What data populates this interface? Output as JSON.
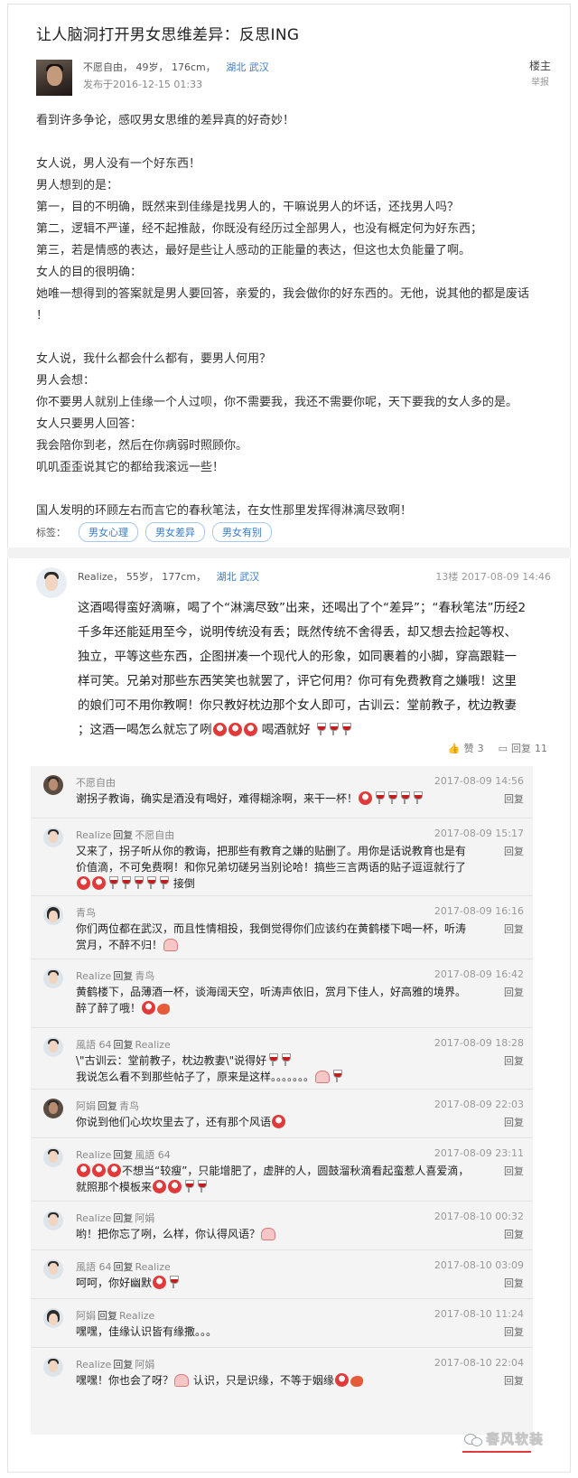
{
  "post": {
    "title": "让人脑洞打开男女思维差异：反思ING",
    "author_name": "不愿自由，",
    "author_info": "49岁， 176cm，",
    "location": "湖北 武汉",
    "published": "发布于2016-12-15 01:33",
    "floor_owner": "楼主",
    "report": "举报",
    "body": [
      "看到许多争论，感叹男女思维的差异真的好奇妙！",
      "",
      "女人说，男人没有一个好东西！",
      "男人想到的是：",
      "第一，目的不明确，既然来到佳缘是找男人的，干嘛说男人的坏话，还找男人吗？",
      "第二，逻辑不严谨，经不起推敲，你既没有经历过全部男人，也没有概定何为好东西；",
      "第三，若是情感的表达，最好是些让人感动的正能量的表达，但这也太负能量了啊。",
      "女人的目的很明确：",
      "她唯一想得到的答案就是男人要回答，亲爱的，我会做你的好东西的。无他，说其他的都是废话",
      "！",
      "",
      "女人说，我什么都会什么都有，要男人何用？",
      "男人会想：",
      "你不要男人就别上佳缘一个人过呗，你不需要我，我还不需要你呢，天下要我的女人多的是。",
      "女人只要男人回答：",
      "我会陪你到老，然后在你病弱时照顾你。",
      "叽叽歪歪说其它的都给我滚远一些！",
      "",
      "国人发明的环顾左右而言它的春秋笔法，在女性那里发挥得淋漓尽致啊！"
    ],
    "tags_label": "标签：",
    "tags": [
      "男女心理",
      "男女差异",
      "男女有别"
    ]
  },
  "reply": {
    "name": "Realize，",
    "info": "55岁， 177cm，",
    "location": "湖北 武汉",
    "floor": "13楼 2017-08-09 14:46",
    "body": [
      "这酒喝得蛮好滴嘛，喝了个“淋漓尽致”出来，还喝出了个“差异”；“春秋笔法”历经2",
      "千多年还能延用至今，说明传统没有丢；既然传统不舍得丢，却又想去捡起等权、",
      "独立，平等这些东西，企图拼凑一个现代人的形象，如同裹着的小脚，穿高跟鞋一",
      "样可笑。兄弟对那些东西笑笑也就罢了，评它何用？你可有免费教育之嫌哦！这里",
      "的娘们可不用你教啊！你只教好枕边那个女人即可，古训云：堂前教子，枕边教妻",
      "；这酒一喝怎么就忘了咧",
      "喝酒就好"
    ],
    "like_label": "赞",
    "like_count": "3",
    "reply_label": "回复",
    "reply_count": "11"
  },
  "sub_comments": [
    {
      "user": "不愿自由",
      "verb": "",
      "target": "",
      "time": "2017-08-09 14:56",
      "reply": "回复",
      "lines": [
        "谢拐子教诲，确实是酒没有喝好，难得糊涂啊，来干一杯！"
      ]
    },
    {
      "user": "Realize",
      "verb": "回复",
      "target": "不愿自由",
      "time": "2017-08-09 15:17",
      "reply": "回复",
      "lines": [
        "又来了，拐子听从你的教诲，把那些有教育之嫌的贴删了。用你是话说教育也是有",
        "价值滴，不可免费啊！和你兄弟切磋另当别论哈！搞些三言两语的贴子逗逗就行了",
        "接倒"
      ]
    },
    {
      "user": "青鸟",
      "verb": "",
      "target": "",
      "time": "2017-08-09 16:16",
      "reply": "回复",
      "lines": [
        "你们两位都在武汉，而且性情相投，我倒觉得你们应该约在黄鹤楼下喝一杯，听涛",
        "赏月，不醉不归！"
      ]
    },
    {
      "user": "Realize",
      "verb": "回复",
      "target": "青鸟",
      "time": "2017-08-09 16:42",
      "reply": "回复",
      "lines": [
        "黄鹤楼下，品薄酒一杯，谈海阔天空，听涛声依旧，赏月下佳人，好高雅的境界。",
        "醉了醉了哦！"
      ]
    },
    {
      "user": "風語 64",
      "verb": "回复",
      "target": "Realize",
      "time": "2017-08-09 18:28",
      "reply": "回复",
      "lines": [
        "\\\"古训云：堂前教子，枕边教妻\\\"说得好",
        "我说怎么看不到那些帖子了，原来是这样。。。。。。。"
      ]
    },
    {
      "user": "阿娟",
      "verb": "回复",
      "target": "青鸟",
      "time": "2017-08-09 22:03",
      "reply": "回复",
      "lines": [
        "你说到他们心坎坎里去了，还有那个风语"
      ]
    },
    {
      "user": "Realize",
      "verb": "回复",
      "target": "風語 64",
      "time": "2017-08-09 23:11",
      "reply": "回复",
      "lines": [
        "不想当“较瘦”，只能增肥了，虚胖的人，圆鼓溜秋滴看起蛮惹人喜爱滴，",
        "就照那个模板来"
      ]
    },
    {
      "user": "Realize",
      "verb": "回复",
      "target": "阿娟",
      "time": "2017-08-10 00:32",
      "reply": "回复",
      "lines": [
        "哟！把你忘了咧，么样，你认得风语？"
      ]
    },
    {
      "user": "風語 64",
      "verb": "回复",
      "target": "Realize",
      "time": "2017-08-10 03:09",
      "reply": "回复",
      "lines": [
        "呵呵，你好幽默"
      ]
    },
    {
      "user": "阿娟",
      "verb": "回复",
      "target": "Realize",
      "time": "2017-08-10 11:24",
      "reply": "回复",
      "lines": [
        "嘿嘿，佳缘认识皆有缘撒。。。"
      ]
    },
    {
      "user": "Realize",
      "verb": "回复",
      "target": "阿娟",
      "time": "2017-08-10 22:04",
      "reply": "回复",
      "lines": [
        "嘿嘿！你也会了呀？",
        "认识，只是识缘，不等于姻缘"
      ]
    }
  ],
  "watermark": "春风软装"
}
